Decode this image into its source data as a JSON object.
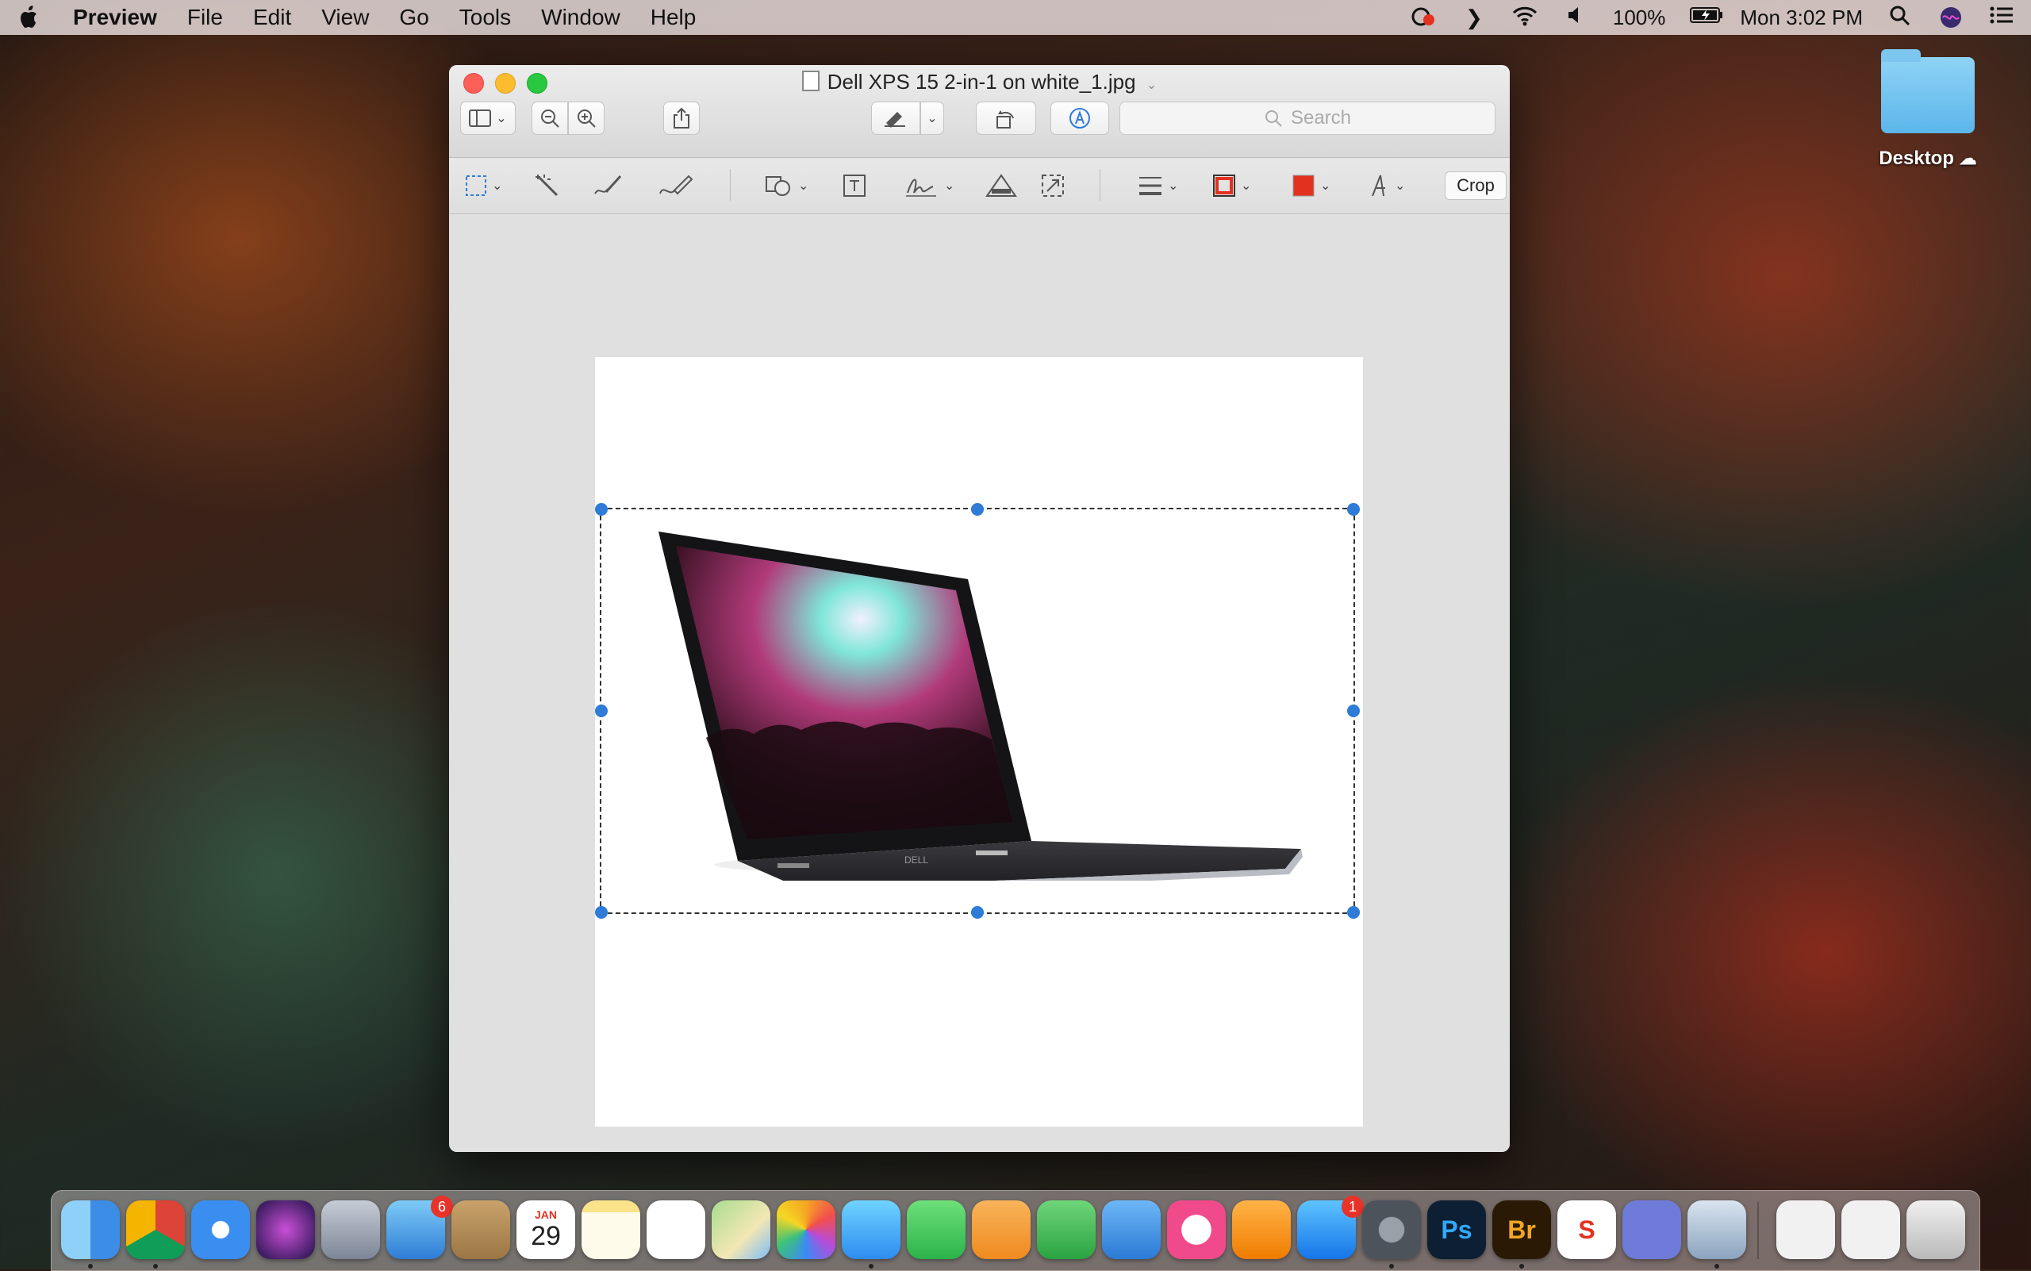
{
  "menubar": {
    "app_name": "Preview",
    "items": [
      "File",
      "Edit",
      "View",
      "Go",
      "Tools",
      "Window",
      "Help"
    ],
    "battery": "100%",
    "clock": "Mon 3:02 PM"
  },
  "desktop": {
    "folder_label": "Desktop"
  },
  "window": {
    "title": "Dell XPS 15 2-in-1 on white_1.jpg",
    "search_placeholder": "Search",
    "crop_label": "Crop"
  },
  "colors": {
    "selection_handle": "#2e7bd8",
    "border_color_swatch": "#e2321f",
    "fill_color_swatch": "#e2321f"
  },
  "dock": {
    "apps": [
      {
        "name": "finder",
        "badge": ""
      },
      {
        "name": "chrome",
        "badge": ""
      },
      {
        "name": "safari",
        "badge": ""
      },
      {
        "name": "siri",
        "badge": ""
      },
      {
        "name": "launchpad",
        "badge": ""
      },
      {
        "name": "mail",
        "badge": "6"
      },
      {
        "name": "contacts",
        "badge": ""
      },
      {
        "name": "calendar",
        "badge": "",
        "month": "JAN",
        "day": "29"
      },
      {
        "name": "notes",
        "badge": ""
      },
      {
        "name": "reminders",
        "badge": ""
      },
      {
        "name": "maps",
        "badge": ""
      },
      {
        "name": "photos",
        "badge": ""
      },
      {
        "name": "messages",
        "badge": ""
      },
      {
        "name": "facetime",
        "badge": ""
      },
      {
        "name": "pages",
        "badge": ""
      },
      {
        "name": "numbers",
        "badge": ""
      },
      {
        "name": "keynote",
        "badge": ""
      },
      {
        "name": "itunes",
        "badge": ""
      },
      {
        "name": "books",
        "badge": ""
      },
      {
        "name": "app-store",
        "badge": "1"
      },
      {
        "name": "system-preferences",
        "badge": ""
      },
      {
        "name": "photoshop",
        "badge": "",
        "text": "Ps"
      },
      {
        "name": "bridge",
        "badge": "",
        "text": "Br"
      },
      {
        "name": "sketch",
        "badge": "",
        "text": "S"
      },
      {
        "name": "discord",
        "badge": ""
      },
      {
        "name": "preview",
        "badge": ""
      },
      {
        "name": "downloads-stack",
        "badge": ""
      },
      {
        "name": "documents-stack",
        "badge": ""
      },
      {
        "name": "trash",
        "badge": ""
      }
    ]
  }
}
